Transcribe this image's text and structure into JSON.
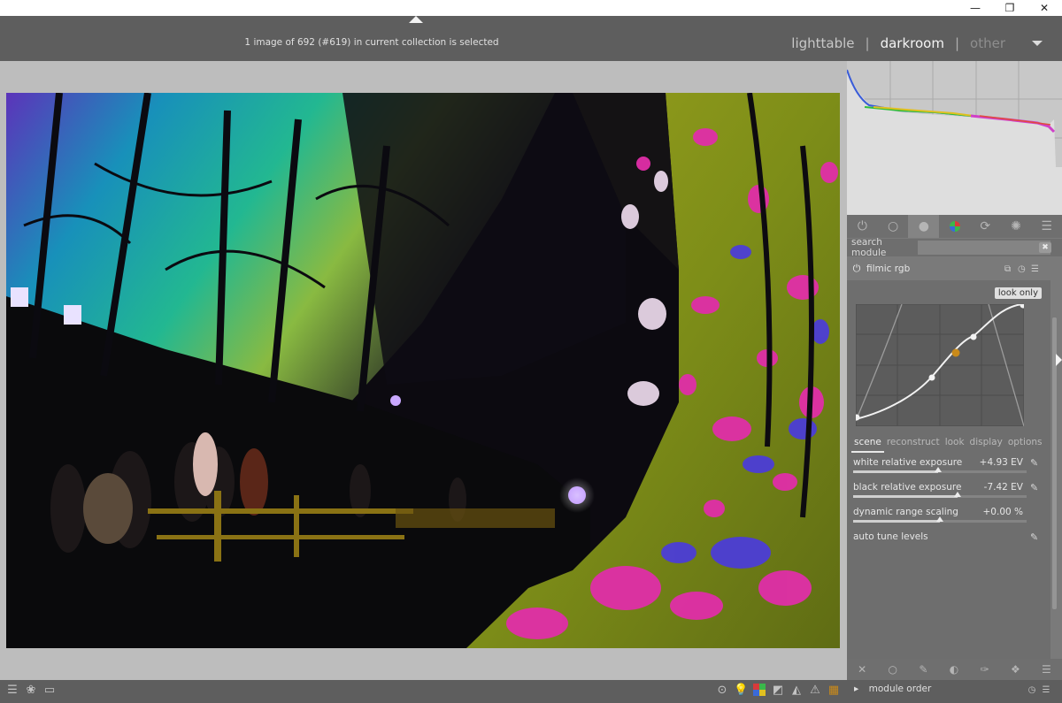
{
  "window": {
    "minimize_glyph": "—",
    "restore_glyph": "❐",
    "close_glyph": "✕"
  },
  "header": {
    "status": "1 image of 692 (#619) in current collection is selected",
    "views": [
      {
        "label": "lighttable",
        "state": "normal"
      },
      {
        "label": "darkroom",
        "state": "active"
      },
      {
        "label": "other",
        "state": "dim"
      }
    ],
    "separator": "|"
  },
  "right_panel": {
    "module_group_icons": [
      "power-icon",
      "circle-icon",
      "filled-circle-icon",
      "color-wheel-icon",
      "refresh-icon",
      "aperture-icon",
      "menu-icon"
    ],
    "module_group_glyphs": [
      "⏻",
      "○",
      "●",
      "◉",
      "⟳",
      "✺",
      "☰"
    ],
    "search": {
      "label": "search module",
      "value": "",
      "placeholder": "",
      "clear_glyph": "✖"
    },
    "module": {
      "power_glyph": "⏻",
      "name": "filmic rgb",
      "header_icons": [
        "⧉",
        "◷",
        "☰"
      ],
      "look_only": "look only",
      "tabs": [
        {
          "label": "scene",
          "active": true
        },
        {
          "label": "reconstruct",
          "active": false
        },
        {
          "label": "look",
          "active": false
        },
        {
          "label": "display",
          "active": false
        },
        {
          "label": "options",
          "active": false
        }
      ],
      "sliders": [
        {
          "label": "white relative exposure",
          "value": "+4.93 EV",
          "position": 0.49,
          "has_picker": true
        },
        {
          "label": "black relative exposure",
          "value": "-7.42 EV",
          "position": 0.6,
          "has_picker": true
        },
        {
          "label": "dynamic range scaling",
          "value": "+0.00 %",
          "position": 0.5,
          "has_picker": false
        }
      ],
      "auto_tune": {
        "label": "auto tune levels",
        "has_picker": true
      },
      "picker_glyph": "✎",
      "bottom_icons": [
        "✕",
        "○",
        "✎",
        "◐",
        "✑",
        "❖",
        "☰"
      ]
    }
  },
  "bottom": {
    "left_icons": [
      "☰",
      "❀",
      "▭"
    ],
    "right_icons": [
      "⊙",
      "💡",
      "▦",
      "◩",
      "◭",
      "⚠",
      "▦"
    ],
    "module_order_label": "module order",
    "module_order_arrow": "▸",
    "module_order_icons": [
      "◷",
      "☰"
    ]
  },
  "colors": {
    "curve_dot_accent": "#c98a1a",
    "tree_pink": "#e02ea8",
    "tree_green": "#8a9a1a",
    "forest_cyan": "#1fd0b8"
  }
}
